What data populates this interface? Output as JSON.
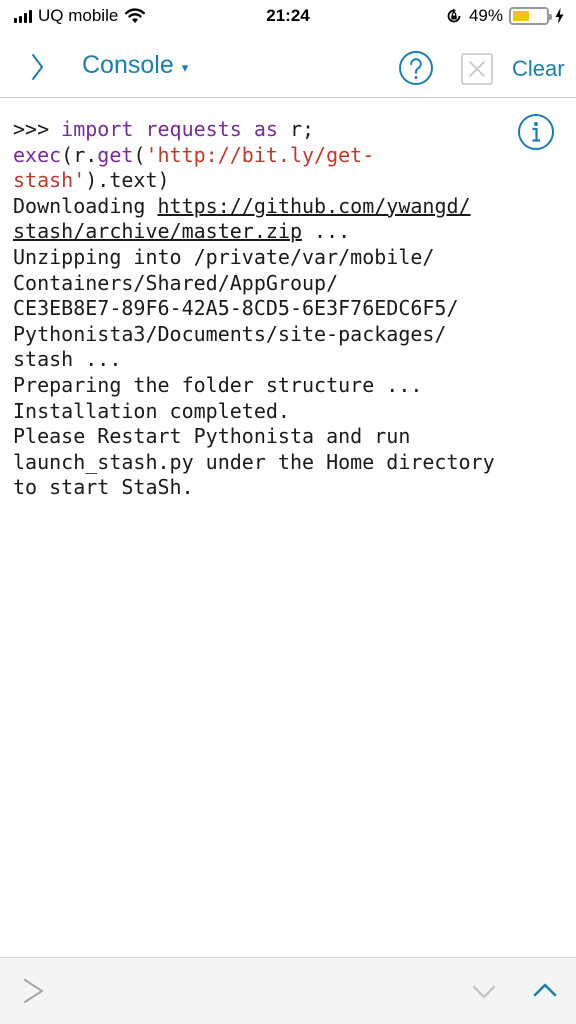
{
  "status_bar": {
    "carrier": "UQ mobile",
    "time": "21:24",
    "battery_percent": "49%",
    "battery_level": 0.49,
    "icons": [
      "signal-icon",
      "wifi-icon",
      "orientation-lock-icon",
      "battery-icon",
      "charging-icon"
    ]
  },
  "nav": {
    "title": "Console",
    "caret": "▾",
    "clear_label": "Clear",
    "accent_color": "#1a7fb5"
  },
  "console": {
    "prompt": ">>> ",
    "kw_import": "import",
    "mod_requests": " requests ",
    "kw_as": "as",
    "alias": " r;",
    "fn_exec": "exec",
    "exec_open": "(r.",
    "fn_get": "get",
    "get_open": "(",
    "url_str_1": "'http://bit.ly/get-",
    "url_str_2": "stash'",
    "text_suffix": ").text)",
    "downloading_prefix": "Downloading ",
    "download_link_1": "https://github.com/ywangd/",
    "download_link_2": "stash/archive/master.zip",
    "download_suffix": " ...",
    "output_lines": [
      "Unzipping into /private/var/mobile/",
      "Containers/Shared/AppGroup/",
      "CE3EB8E7-89F6-42A5-8CD5-6E3F76EDC6F5/",
      "Pythonista3/Documents/site-packages/",
      "stash ...",
      "Preparing the folder structure ...",
      "Installation completed.",
      "Please Restart Pythonista and run",
      "launch_stash.py under the Home directory",
      "to start StaSh."
    ]
  }
}
